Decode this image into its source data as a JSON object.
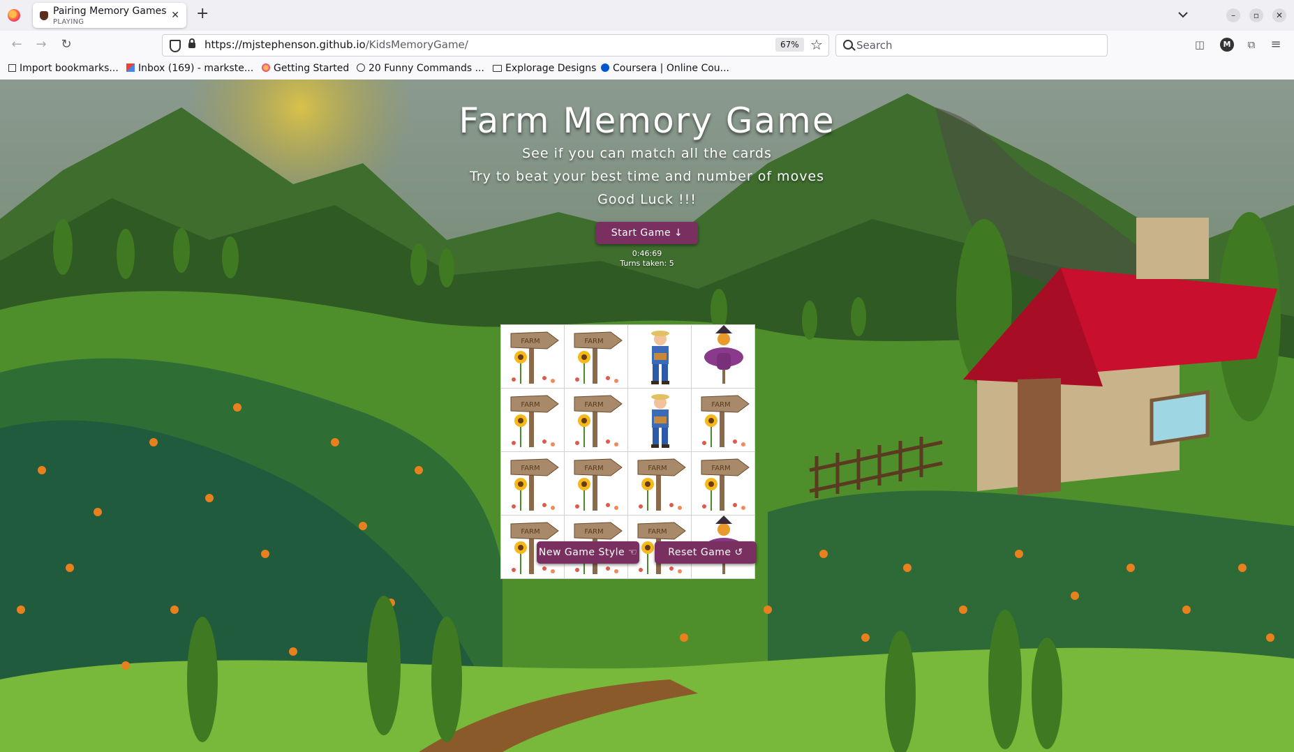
{
  "browser": {
    "tab": {
      "title": "Pairing Memory Games",
      "status": "PLAYING"
    },
    "url": {
      "host": "https://mjstephenson.github.io",
      "path": "/KidsMemoryGame/"
    },
    "zoom": "67%",
    "search_placeholder": "Search",
    "account_initial": "M",
    "bookmarks": [
      "Import bookmarks...",
      "Inbox (169) - markste...",
      "Getting Started",
      "20 Funny Commands ...",
      "Explorage Designs",
      "Coursera | Online Cou..."
    ]
  },
  "game": {
    "title": "Farm Memory Game",
    "intro_lines": [
      "See if you can match all the cards",
      "Try to beat your best time and number of moves",
      "Good Luck !!!"
    ],
    "start_button": "Start Game ↓",
    "timer": "0:46:69",
    "turns": "Turns taken: 5",
    "new_style_button": "New Game Style ☜",
    "reset_button": "Reset Game ↺",
    "cards": [
      "farm-sign",
      "farm-sign",
      "farmer",
      "scarecrow",
      "farm-sign",
      "farm-sign",
      "farmer",
      "farm-sign",
      "farm-sign",
      "farm-sign",
      "farm-sign",
      "farm-sign",
      "farm-sign",
      "farm-sign",
      "farm-sign",
      "scarecrow"
    ],
    "card_sign_text": "FARM"
  },
  "colors": {
    "button": "#7a2f61",
    "sky": "#7a8f86",
    "grass": "#6fae2f",
    "roof": "#c8102e"
  }
}
